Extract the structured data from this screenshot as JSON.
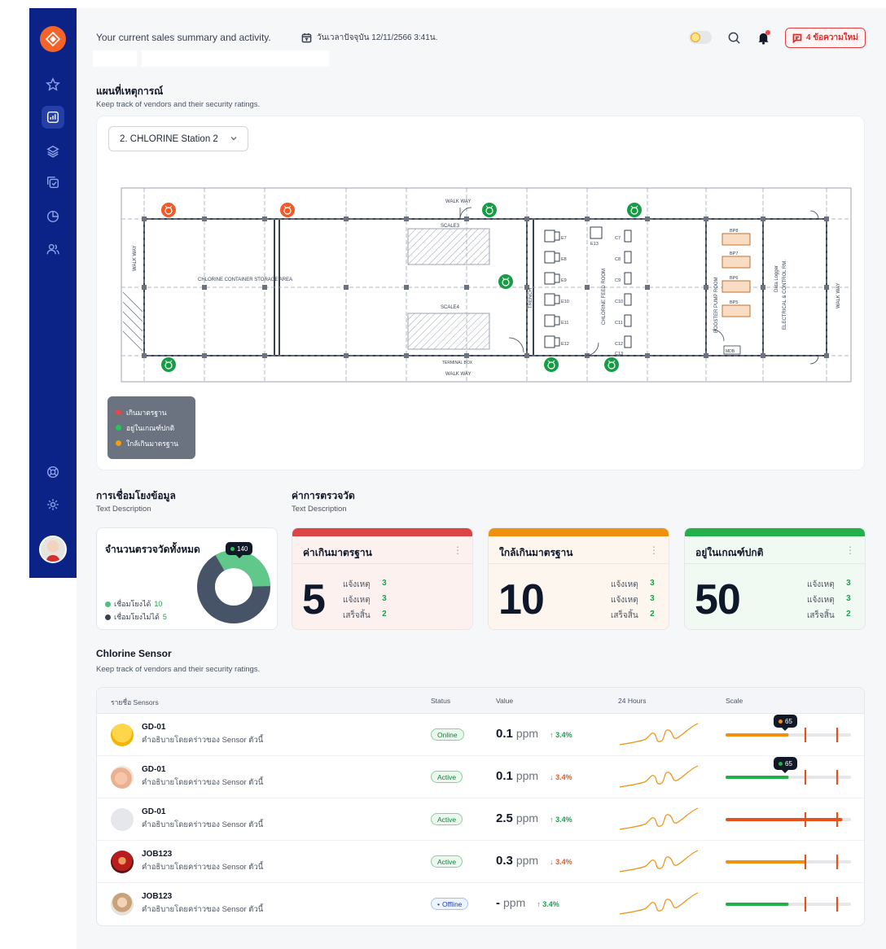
{
  "header": {
    "greeting": "Your current sales summary and activity.",
    "datetime": "วันเวลาปัจจุบัน 12/11/2566 3:41น.",
    "messages_button": "4 ข้อความใหม่"
  },
  "map_section": {
    "title": "แผนที่เหตุการณ์",
    "subtitle": "Keep track of vendors and their security ratings.",
    "station_select": "2. CHLORINE Station 2",
    "floorplan_labels": {
      "storage_area": "CHLORINE CONTAINER STORAGE AREA",
      "walk_way": "WALK WAY",
      "scale3": "SCALE3",
      "scale4": "SCALE4",
      "terminal_box": "TERMINAL BOX",
      "trench": "TRENCH",
      "feed_room": "CHLORINE FEED ROOM",
      "booster_room": "BOOSTER PUMP ROOM",
      "electrical_room": "ELECTRICAL & CONTROL RM.",
      "data_logger": "Data Logger",
      "mdb": "MDB",
      "e_labels": [
        "E7",
        "E8",
        "E9",
        "E10",
        "E11",
        "E12",
        "E13"
      ],
      "c_labels": [
        "C7",
        "C8",
        "C9",
        "C10",
        "C11",
        "C12",
        "C13"
      ],
      "bp_labels": [
        "BP8",
        "BP7",
        "BP6",
        "BP5"
      ]
    },
    "legend": [
      {
        "label": "เกินมาตรฐาน",
        "color": "#ef4444"
      },
      {
        "label": "อยู่ในเกณฑ์ปกติ",
        "color": "#22c55e"
      },
      {
        "label": "ใกล้เกินมาตรฐาน",
        "color": "#f59e0b"
      }
    ]
  },
  "connection": {
    "title": "การเชื่อมโยงข้อมูล",
    "subtitle": "Text Description",
    "card_title": "จำนวนตรวจวัดทั้งหมด",
    "connected_label": "เชื่อมโยงได้",
    "connected_value": "10",
    "disconnected_label": "เชื่อมโยงไม่ได้",
    "disconnected_value": "5",
    "tooltip": "140",
    "donut_fraction_connected": 0.33
  },
  "measurement": {
    "title": "ค่าการตรวจวัด",
    "subtitle": "Text Description",
    "cards": [
      {
        "title": "ค่าเกินมาตรฐาน",
        "value": "5",
        "color": "#dc4545",
        "bg": "#fdf1f0",
        "rows": [
          {
            "label": "แจ้งเหตุ",
            "n": "3"
          },
          {
            "label": "แจ้งเหตุ",
            "n": "3"
          },
          {
            "label": "เสร็จสิ้น",
            "n": "2"
          }
        ]
      },
      {
        "title": "ใกล้เกินมาตรฐาน",
        "value": "10",
        "color": "#f0900f",
        "bg": "#fdf6ef",
        "rows": [
          {
            "label": "แจ้งเหตุ",
            "n": "3"
          },
          {
            "label": "แจ้งเหตุ",
            "n": "3"
          },
          {
            "label": "เสร็จสิ้น",
            "n": "2"
          }
        ]
      },
      {
        "title": "อยู่ในเกณฑ์ปกติ",
        "value": "50",
        "color": "#22b04b",
        "bg": "#f1f9f3",
        "rows": [
          {
            "label": "แจ้งเหตุ",
            "n": "3"
          },
          {
            "label": "แจ้งเหตุ",
            "n": "3"
          },
          {
            "label": "เสร็จสิ้น",
            "n": "2"
          }
        ]
      }
    ],
    "more_icon": "⋮"
  },
  "sensors": {
    "title": "Chlorine Sensor",
    "subtitle": "Keep track of vendors and their security ratings.",
    "columns": {
      "name": "รายชื่อ Sensors",
      "status": "Status",
      "value": "Value",
      "hours": "24 Hours",
      "scale": "Scale"
    },
    "rows": [
      {
        "name": "GD-01",
        "desc": "คำอธิบายโดยคร่าวของ Sensor ตัวนี้",
        "status": "Online",
        "status_style": "green",
        "value": "0.1",
        "unit": "ppm",
        "change": "3.4%",
        "trend": "up",
        "scale_color": "#f0900f",
        "scale_fill": 0.49,
        "tooltip": "65",
        "tooltip_dot": "#f0900f"
      },
      {
        "name": "GD-01",
        "desc": "คำอธิบายโดยคร่าวของ Sensor ตัวนี้",
        "status": "Active",
        "status_style": "green",
        "value": "0.1",
        "unit": "ppm",
        "change": "3.4%",
        "trend": "down",
        "scale_color": "#22b04b",
        "scale_fill": 0.49,
        "tooltip": "65",
        "tooltip_dot": "#22b04b"
      },
      {
        "name": "GD-01",
        "desc": "คำอธิบายโดยคร่าวของ Sensor ตัวนี้",
        "status": "Active",
        "status_style": "green",
        "value": "2.5",
        "unit": "ppm",
        "change": "3.4%",
        "trend": "up",
        "scale_color": "#e5531a",
        "scale_fill": 0.93
      },
      {
        "name": "JOB123",
        "desc": "คำอธิบายโดยคร่าวของ Sensor ตัวนี้",
        "status": "Active",
        "status_style": "green",
        "value": "0.3",
        "unit": "ppm",
        "change": "3.4%",
        "trend": "down",
        "scale_color": "#f0900f",
        "scale_fill": 0.63
      },
      {
        "name": "JOB123",
        "desc": "คำอธิบายโดยคร่าวของ Sensor ตัวนี้",
        "status": "Offline",
        "status_style": "blue",
        "value": "-",
        "unit": "ppm",
        "change": "3.4%",
        "trend": "up",
        "scale_color": "#22b04b",
        "scale_fill": 0.49
      }
    ]
  }
}
